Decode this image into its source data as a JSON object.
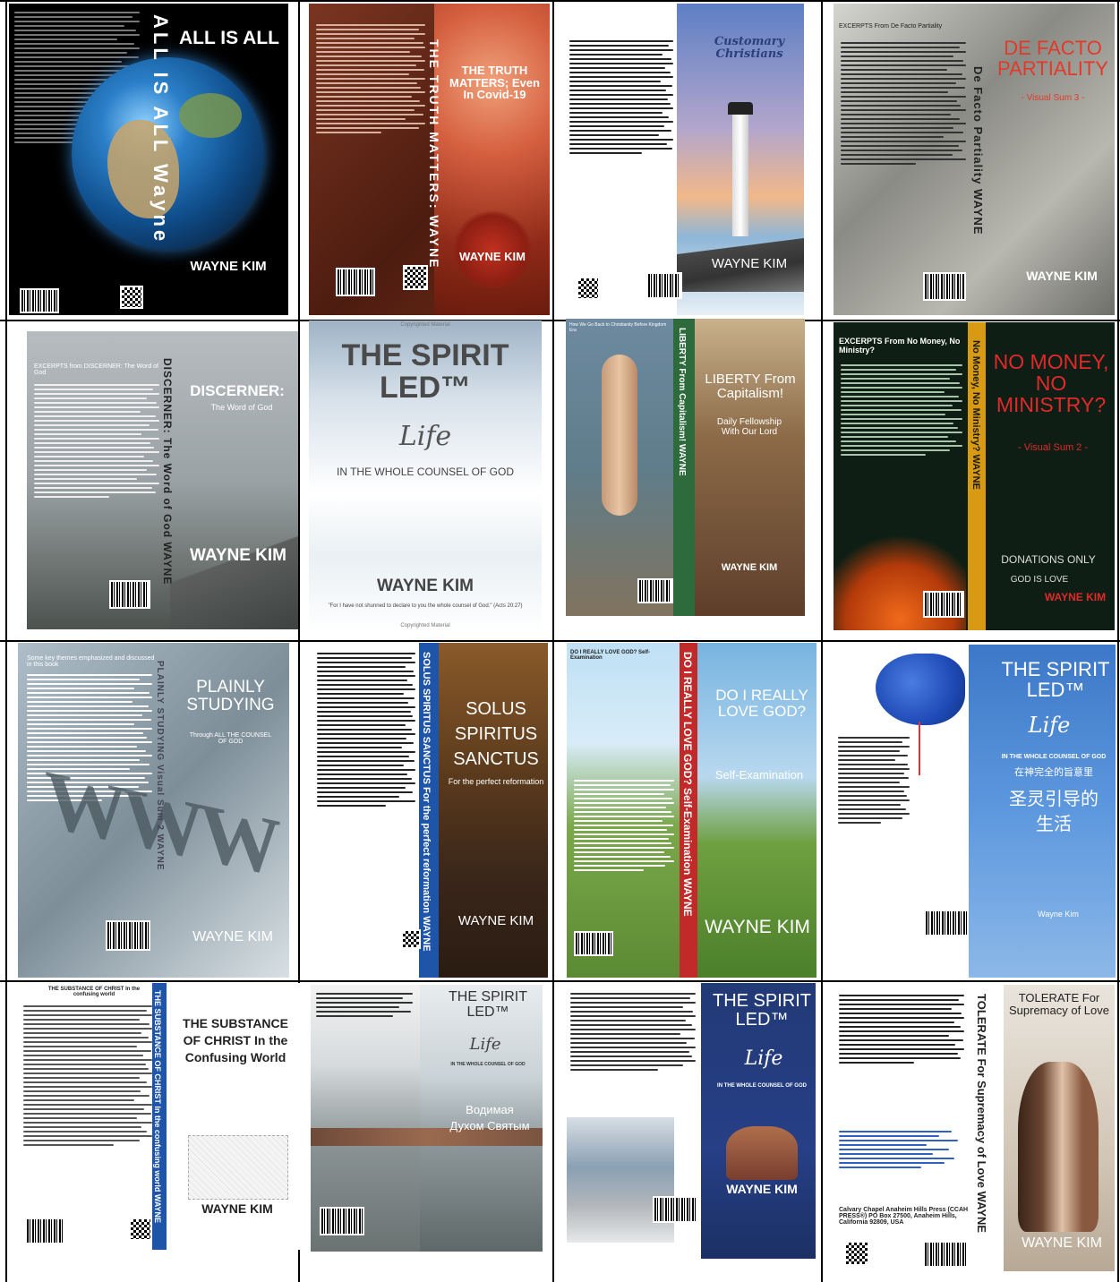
{
  "covers": [
    {
      "title": "ALL IS ALL",
      "spine": "ALL IS ALL  Wayne",
      "author": "WAYNE KIM"
    },
    {
      "title": "THE TRUTH MATTERS; Even In Covid-19",
      "spine": "THE TRUTH MATTERS:   WAYNE",
      "author": "WAYNE KIM"
    },
    {
      "title": "Customary Christians",
      "spine": "",
      "author": "WAYNE KIM"
    },
    {
      "title": "DE FACTO PARTIALITY",
      "subtitle": "- Visual Sum 3 -",
      "excerpt": "EXCERPTS From De Facto Partiality",
      "spine": "De Facto Partiality   WAYNE",
      "author": "WAYNE KIM"
    },
    {
      "title": "DISCERNER:",
      "subtitle": "The Word of God",
      "excerpt": "EXCERPTS from DISCERNER: The Word of God",
      "spine": "DISCERNER: The Word of God   WAYNE",
      "author": "WAYNE KIM"
    },
    {
      "title": "THE SPIRIT LED™",
      "script": "Life",
      "subtitle": "IN THE WHOLE COUNSEL OF GOD",
      "top": "Copyrighted Material",
      "author": "WAYNE  KIM",
      "quote": "\"For I have not shunned to declare to you the whole counsel of God.\" (Acts 20:27)",
      "bottom": "Copyrighted Material"
    },
    {
      "title": "LIBERTY From Capitalism!",
      "subtitle": "Daily Fellowship With Our Lord",
      "excerpt": "How We Go Back to Christianity Before Kingdom Era",
      "spine": "LIBERTY From Capitalism!   WAYNE",
      "author": "WAYNE KIM"
    },
    {
      "title": "NO MONEY, NO MINISTRY?",
      "subtitle": "- Visual Sum 2 -",
      "excerpt": "EXCERPTS From No Money, No Ministry?",
      "spine": "No Money, No Ministry?   WAYNE",
      "author": "WAYNE KIM",
      "sign1": "DONATIONS ONLY",
      "sign2": "GOD IS LOVE"
    },
    {
      "title": "PLAINLY STUDYING",
      "subtitle": "Through ALL THE COUNSEL OF GOD",
      "excerpt": "Some key themes emphasized and discussed in this book",
      "spine": "PLAINLY STUDYING  Visual Sum 2   WAYNE",
      "author": "WAYNE KIM"
    },
    {
      "title": "SOLUS SPIRITUS SANCTUS",
      "subtitle": "For the perfect reformation",
      "spine": "SOLUS SPIRITUS SANCTUS  For the perfect reformation   WAYNE",
      "author": "WAYNE KIM"
    },
    {
      "title": "DO I REALLY LOVE GOD?",
      "subtitle": "Self-Examination",
      "excerpt": "DO I REALLY LOVE GOD? Self-Examination",
      "spine": "DO I REALLY LOVE GOD?  Self-Examination   WAYNE",
      "author": "WAYNE KIM"
    },
    {
      "title": "THE SPIRIT LED™",
      "script": "Life",
      "subtitle": "IN THE WHOLE COUNSEL OF GOD",
      "cjk1": "在神完全的旨意里",
      "cjk2": "圣灵引导的",
      "cjk3": "生活",
      "author": "Wayne Kim",
      "spine": ""
    },
    {
      "title": "THE SUBSTANCE OF CHRIST In the Confusing World",
      "excerpt": "THE SUBSTANCE OF CHRIST In the confusing world",
      "spine": "THE SUBSTANCE OF CHRIST In the confusing world   WAYNE",
      "author": "WAYNE KIM"
    },
    {
      "title": "THE SPIRIT LED™",
      "script": "Life",
      "subtitle": "IN THE WHOLE COUNSEL OF GOD",
      "cyr1": "Водимая",
      "cyr2": "Духом Святым",
      "author": ""
    },
    {
      "title": "THE SPIRIT LED™",
      "script": "Life",
      "subtitle": "IN THE WHOLE COUNSEL OF GOD",
      "author": "WAYNE KIM"
    },
    {
      "title": "TOLERATE For Supremacy of Love",
      "spine": "TOLERATE For Supremacy of Love   WAYNE",
      "author": "WAYNE KIM",
      "address": "Calvary Chapel Anaheim Hills Press (CCAH PRESS®) PO Box 27500, Anaheim Hills, California 92809, USA"
    }
  ]
}
